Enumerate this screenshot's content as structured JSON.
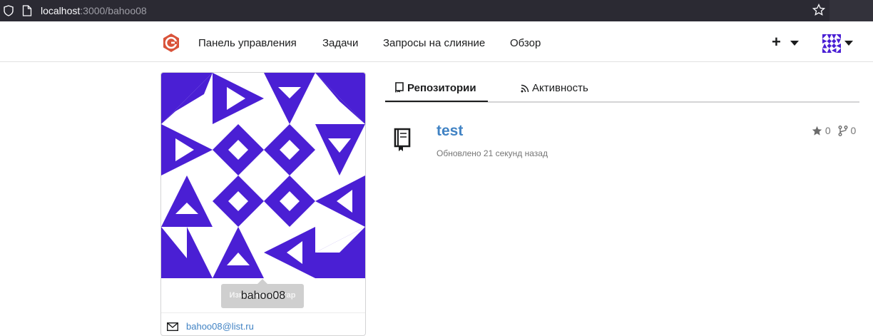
{
  "browser": {
    "url_host": "localhost",
    "url_path": ":3000/bahoo08"
  },
  "nav": {
    "items": [
      {
        "label": "Панель управления"
      },
      {
        "label": "Задачи"
      },
      {
        "label": "Запросы на слияние"
      },
      {
        "label": "Обзор"
      }
    ],
    "create_label": "+"
  },
  "profile": {
    "username": "bahoo08",
    "tooltip_hidden_text": "Изменить аватар",
    "email": "bahoo08@list.ru"
  },
  "tabs": {
    "repositories": "Репозитории",
    "activity": "Активность"
  },
  "repo": {
    "name": "test",
    "updated": "Обновлено 21 секунд назад",
    "stars": "0",
    "forks": "0"
  },
  "colors": {
    "identicon": "#4a1fd4",
    "link": "#4183c4",
    "logo": "#d9533a"
  }
}
